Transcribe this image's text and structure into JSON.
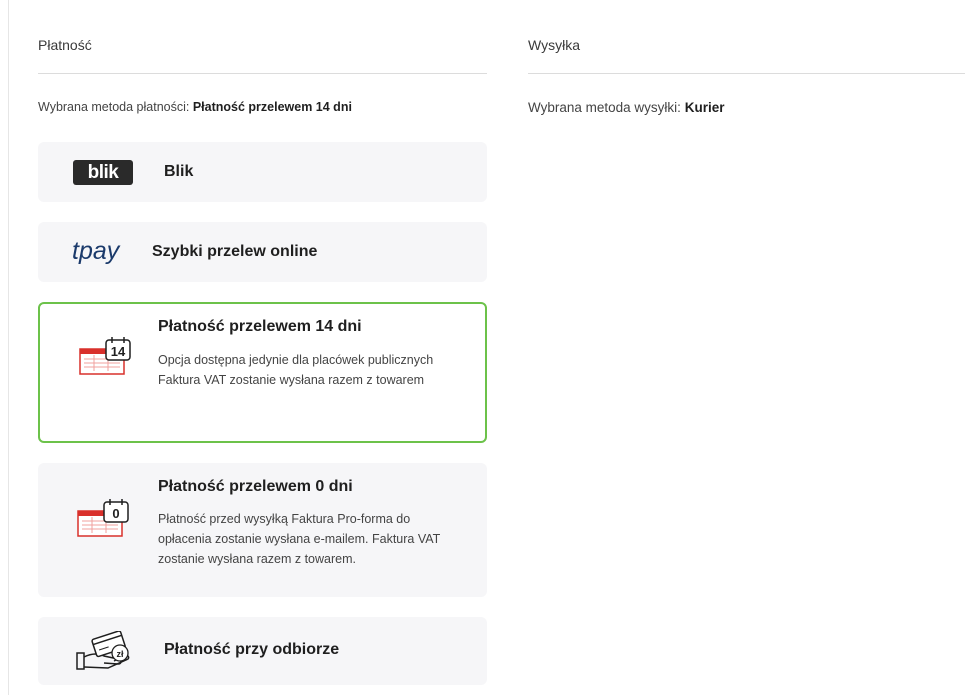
{
  "payment": {
    "title": "Płatność",
    "selected_label": "Wybrana metoda płatności:",
    "selected_value": "Płatność przelewem 14 dni",
    "methods": [
      {
        "name": "Blik",
        "logo_text": "blik",
        "icon": "blik-logo-icon"
      },
      {
        "name": "Szybki przelew online",
        "logo_text": "tpay",
        "icon": "tpay-logo-icon"
      },
      {
        "name": "Płatność przelewem 14 dni",
        "description": "Opcja dostępna jedynie dla placówek publicznych Faktura VAT zostanie wysłana razem z towarem",
        "icon_number": "14",
        "icon": "calendar-invoice-14-icon",
        "selected": true
      },
      {
        "name": "Płatność przelewem 0 dni",
        "description": "Płatność przed wysyłką Faktura Pro-forma do opłacenia zostanie wysłana e-mailem. Faktura VAT zostanie wysłana razem z towarem.",
        "icon_number": "0",
        "icon": "calendar-invoice-0-icon"
      },
      {
        "name": "Płatność przy odbiorze",
        "icon_text": "zł",
        "icon": "hand-card-cash-icon"
      }
    ]
  },
  "shipping": {
    "title": "Wysyłka",
    "selected_label": "Wybrana metoda wysyłki:",
    "selected_value": "Kurier"
  },
  "colors": {
    "selected_border": "#6cc24a",
    "card_background": "#f6f6f8",
    "icon_red": "#d9302b"
  }
}
